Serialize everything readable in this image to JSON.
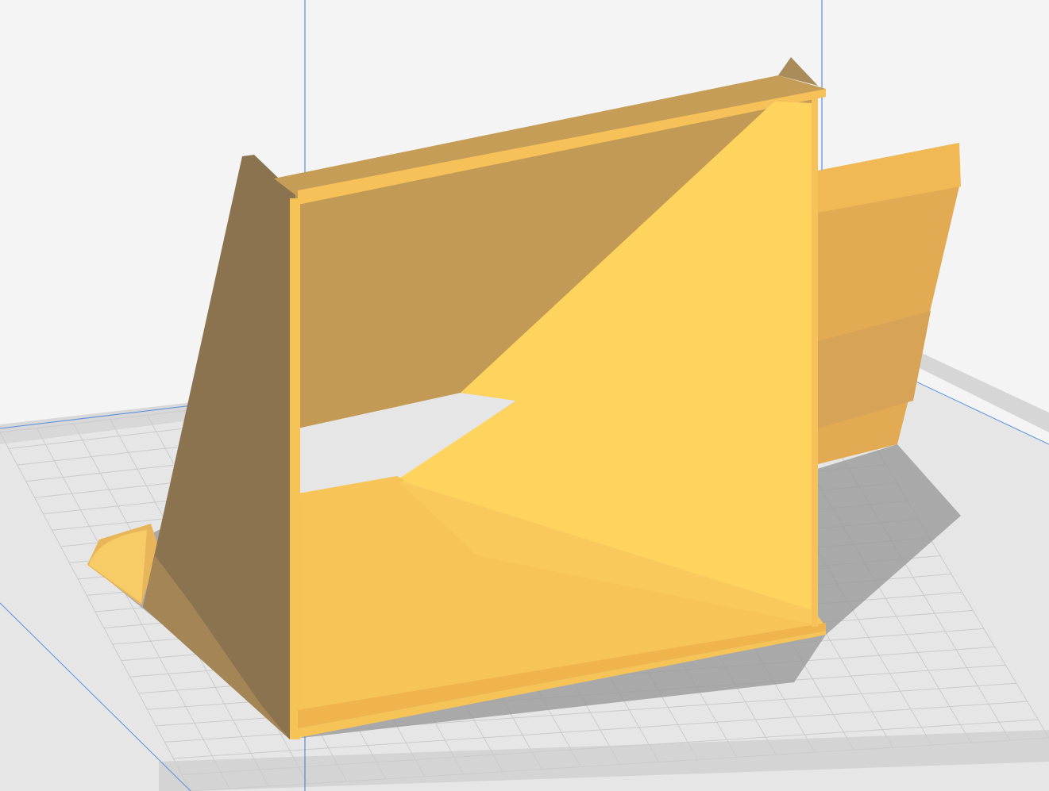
{
  "viewport": {
    "background_color": "#f4f4f4",
    "bed": {
      "surface_color": "#e6e6e6",
      "edge_color": "#d2d2d2",
      "grid_color": "#c8c8c8",
      "border_line_color": "#5b8fe0"
    },
    "axis_line_color": "#3a78d8",
    "model": {
      "name_icon": "3d-model-icon",
      "light_color": "#ffd45e",
      "mid_color": "#f6c457",
      "shade_color": "#c39a55",
      "dark_color": "#8c7350",
      "shadow_color": "#9a9a9a"
    }
  }
}
